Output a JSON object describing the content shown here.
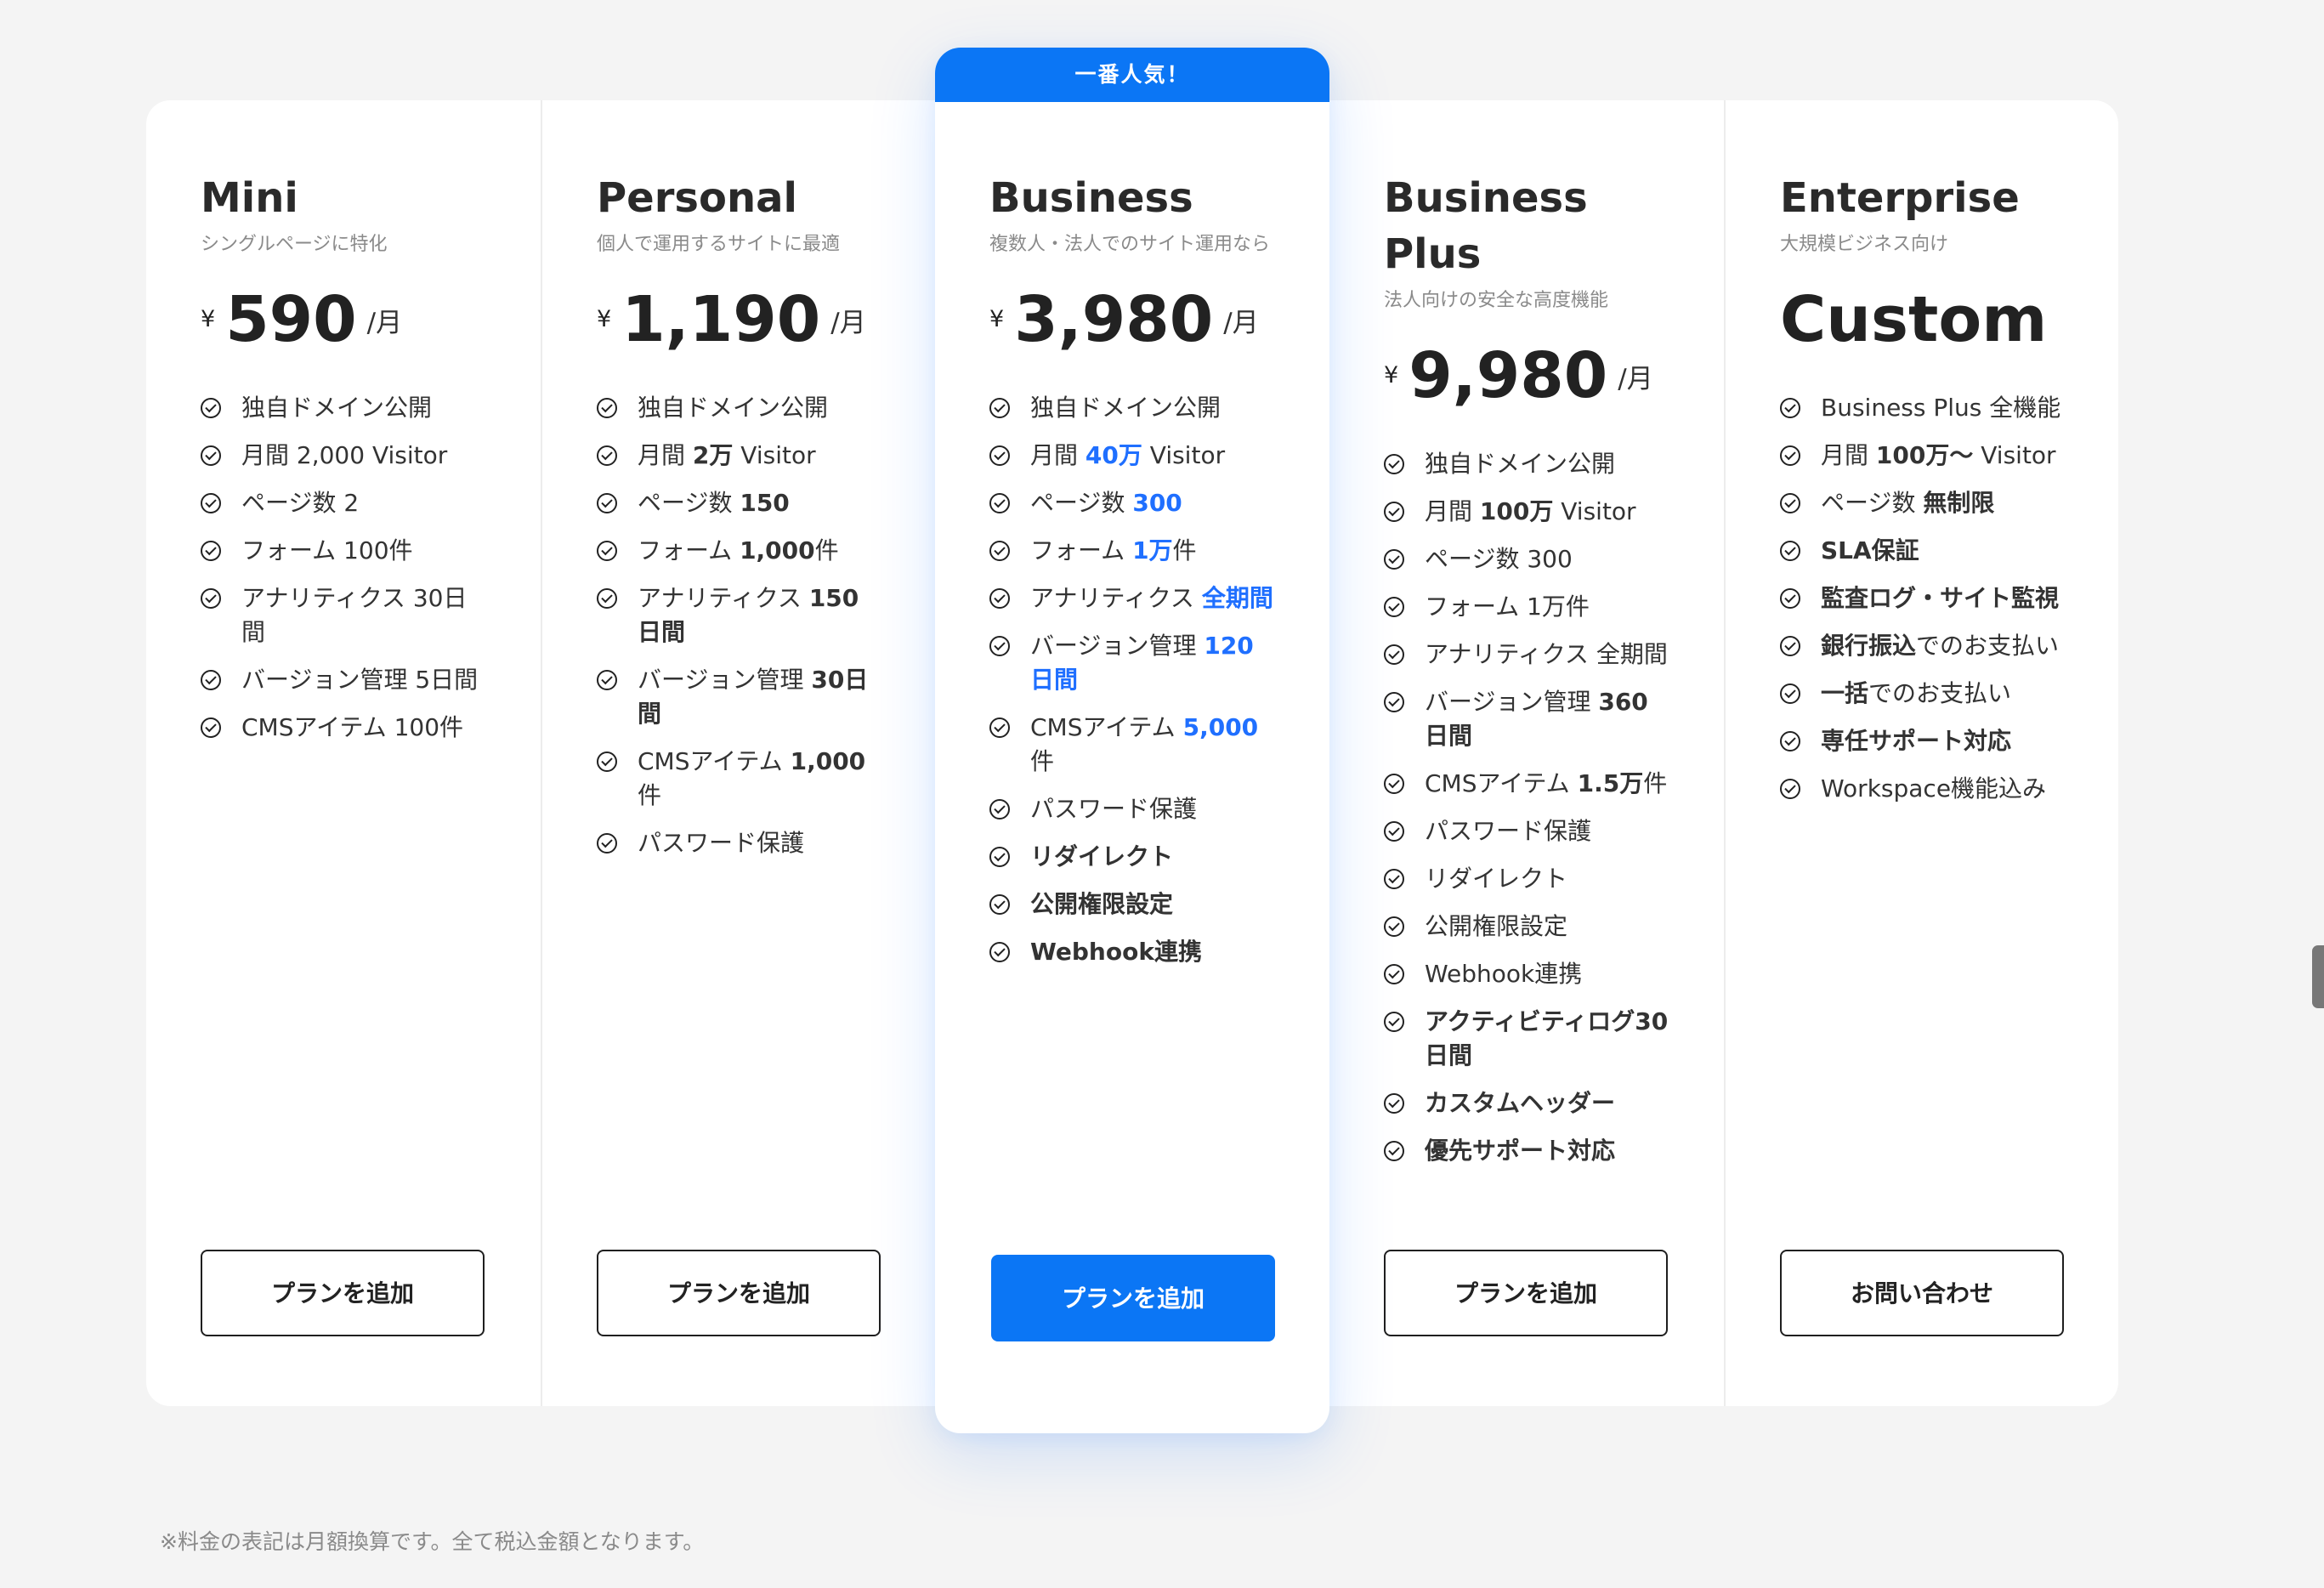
{
  "ribbon": {
    "label": "一番人気！"
  },
  "plans": [
    {
      "name": "Mini",
      "subtitle": "シングルページに特化",
      "price": {
        "currency": "¥",
        "amount": "590",
        "unit": "/月"
      },
      "features": [
        {
          "segments": [
            {
              "text": "独自ドメイン公開",
              "style": "normal"
            }
          ]
        },
        {
          "segments": [
            {
              "text": "月間 2,000 Visitor",
              "style": "normal"
            }
          ]
        },
        {
          "segments": [
            {
              "text": "ページ数 2",
              "style": "normal"
            }
          ]
        },
        {
          "segments": [
            {
              "text": "フォーム 100件",
              "style": "normal"
            }
          ]
        },
        {
          "segments": [
            {
              "text": "アナリティクス 30日間",
              "style": "normal"
            }
          ]
        },
        {
          "segments": [
            {
              "text": "バージョン管理 5日間",
              "style": "normal"
            }
          ]
        },
        {
          "segments": [
            {
              "text": "CMSアイテム 100件",
              "style": "normal"
            }
          ]
        }
      ],
      "button": "プランを追加"
    },
    {
      "name": "Personal",
      "subtitle": "個人で運用するサイトに最適",
      "price": {
        "currency": "¥",
        "amount": "1,190",
        "unit": "/月"
      },
      "features": [
        {
          "segments": [
            {
              "text": "独自ドメイン公開",
              "style": "normal"
            }
          ]
        },
        {
          "segments": [
            {
              "text": "月間 ",
              "style": "normal"
            },
            {
              "text": "2万",
              "style": "bold"
            },
            {
              "text": " Visitor",
              "style": "normal"
            }
          ]
        },
        {
          "segments": [
            {
              "text": "ページ数 ",
              "style": "normal"
            },
            {
              "text": "150",
              "style": "bold"
            }
          ]
        },
        {
          "segments": [
            {
              "text": "フォーム ",
              "style": "normal"
            },
            {
              "text": "1,000",
              "style": "bold"
            },
            {
              "text": "件",
              "style": "normal"
            }
          ]
        },
        {
          "segments": [
            {
              "text": "アナリティクス ",
              "style": "normal"
            },
            {
              "text": "150日間",
              "style": "bold"
            }
          ]
        },
        {
          "segments": [
            {
              "text": "バージョン管理 ",
              "style": "normal"
            },
            {
              "text": "30日間",
              "style": "bold"
            }
          ]
        },
        {
          "segments": [
            {
              "text": "CMSアイテム ",
              "style": "normal"
            },
            {
              "text": "1,000",
              "style": "bold"
            },
            {
              "text": "件",
              "style": "normal"
            }
          ]
        },
        {
          "segments": [
            {
              "text": "パスワード保護",
              "style": "normal"
            }
          ]
        }
      ],
      "button": "プランを追加"
    },
    {
      "name": "Business",
      "subtitle": "複数人・法人でのサイト運用なら",
      "price": {
        "currency": "¥",
        "amount": "3,980",
        "unit": "/月"
      },
      "featured": true,
      "features": [
        {
          "segments": [
            {
              "text": "独自ドメイン公開",
              "style": "normal"
            }
          ]
        },
        {
          "segments": [
            {
              "text": "月間 ",
              "style": "normal"
            },
            {
              "text": "40万",
              "style": "blue"
            },
            {
              "text": " Visitor",
              "style": "normal"
            }
          ]
        },
        {
          "segments": [
            {
              "text": "ページ数 ",
              "style": "normal"
            },
            {
              "text": "300",
              "style": "blue"
            }
          ]
        },
        {
          "segments": [
            {
              "text": "フォーム ",
              "style": "normal"
            },
            {
              "text": "1万",
              "style": "blue"
            },
            {
              "text": "件",
              "style": "normal"
            }
          ]
        },
        {
          "segments": [
            {
              "text": "アナリティクス ",
              "style": "normal"
            },
            {
              "text": "全期間",
              "style": "blue"
            }
          ]
        },
        {
          "segments": [
            {
              "text": "バージョン管理 ",
              "style": "normal"
            },
            {
              "text": "120日間",
              "style": "blue"
            }
          ]
        },
        {
          "segments": [
            {
              "text": "CMSアイテム ",
              "style": "normal"
            },
            {
              "text": "5,000",
              "style": "blue"
            },
            {
              "text": "件",
              "style": "normal"
            }
          ]
        },
        {
          "segments": [
            {
              "text": "パスワード保護",
              "style": "normal"
            }
          ]
        },
        {
          "segments": [
            {
              "text": "リダイレクト",
              "style": "bold"
            }
          ]
        },
        {
          "segments": [
            {
              "text": "公開権限設定",
              "style": "bold"
            }
          ]
        },
        {
          "segments": [
            {
              "text": "Webhook連携",
              "style": "bold"
            }
          ]
        }
      ],
      "button": "プランを追加"
    },
    {
      "name": "Business\nPlus",
      "subtitle": "法人向けの安全な高度機能",
      "price": {
        "currency": "¥",
        "amount": "9,980",
        "unit": "/月"
      },
      "features": [
        {
          "segments": [
            {
              "text": "独自ドメイン公開",
              "style": "normal"
            }
          ]
        },
        {
          "segments": [
            {
              "text": "月間 ",
              "style": "normal"
            },
            {
              "text": "100万",
              "style": "bold"
            },
            {
              "text": " Visitor",
              "style": "normal"
            }
          ]
        },
        {
          "segments": [
            {
              "text": "ページ数 300",
              "style": "normal"
            }
          ]
        },
        {
          "segments": [
            {
              "text": "フォーム 1万件",
              "style": "normal"
            }
          ]
        },
        {
          "segments": [
            {
              "text": "アナリティクス 全期間",
              "style": "normal"
            }
          ]
        },
        {
          "segments": [
            {
              "text": "バージョン管理 ",
              "style": "normal"
            },
            {
              "text": "360日間",
              "style": "bold"
            }
          ]
        },
        {
          "segments": [
            {
              "text": "CMSアイテム ",
              "style": "normal"
            },
            {
              "text": "1.5万",
              "style": "bold"
            },
            {
              "text": "件",
              "style": "normal"
            }
          ]
        },
        {
          "segments": [
            {
              "text": "パスワード保護",
              "style": "normal"
            }
          ]
        },
        {
          "segments": [
            {
              "text": "リダイレクト",
              "style": "normal"
            }
          ]
        },
        {
          "segments": [
            {
              "text": "公開権限設定",
              "style": "normal"
            }
          ]
        },
        {
          "segments": [
            {
              "text": "Webhook連携",
              "style": "normal"
            }
          ]
        },
        {
          "segments": [
            {
              "text": "アクティビティログ30日間",
              "style": "bold"
            }
          ]
        },
        {
          "segments": [
            {
              "text": "カスタムヘッダー",
              "style": "bold"
            }
          ]
        },
        {
          "segments": [
            {
              "text": "優先サポート対応",
              "style": "bold"
            }
          ]
        }
      ],
      "button": "プランを追加"
    },
    {
      "name": "Enterprise",
      "subtitle": "大規模ビジネス向け",
      "custom_price": "Custom",
      "features": [
        {
          "segments": [
            {
              "text": "Business Plus 全機能",
              "style": "normal"
            }
          ]
        },
        {
          "segments": [
            {
              "text": "月間 ",
              "style": "normal"
            },
            {
              "text": "100万〜",
              "style": "bold"
            },
            {
              "text": " Visitor",
              "style": "normal"
            }
          ]
        },
        {
          "segments": [
            {
              "text": "ページ数 ",
              "style": "normal"
            },
            {
              "text": "無制限",
              "style": "bold"
            }
          ]
        },
        {
          "segments": [
            {
              "text": "SLA保証",
              "style": "bold"
            }
          ]
        },
        {
          "segments": [
            {
              "text": "監査ログ・サイト監視",
              "style": "bold"
            }
          ]
        },
        {
          "segments": [
            {
              "text": "銀行振込",
              "style": "bold"
            },
            {
              "text": "でのお支払い",
              "style": "normal"
            }
          ]
        },
        {
          "segments": [
            {
              "text": "一括",
              "style": "bold"
            },
            {
              "text": "でのお支払い",
              "style": "normal"
            }
          ]
        },
        {
          "segments": [
            {
              "text": "専任サポート対応",
              "style": "bold"
            }
          ]
        },
        {
          "segments": [
            {
              "text": "Workspace機能込み",
              "style": "normal"
            }
          ]
        }
      ],
      "button": "お問い合わせ"
    }
  ],
  "footer": {
    "note": "※料金の表記は月額換算です。全て税込金額となります。"
  }
}
